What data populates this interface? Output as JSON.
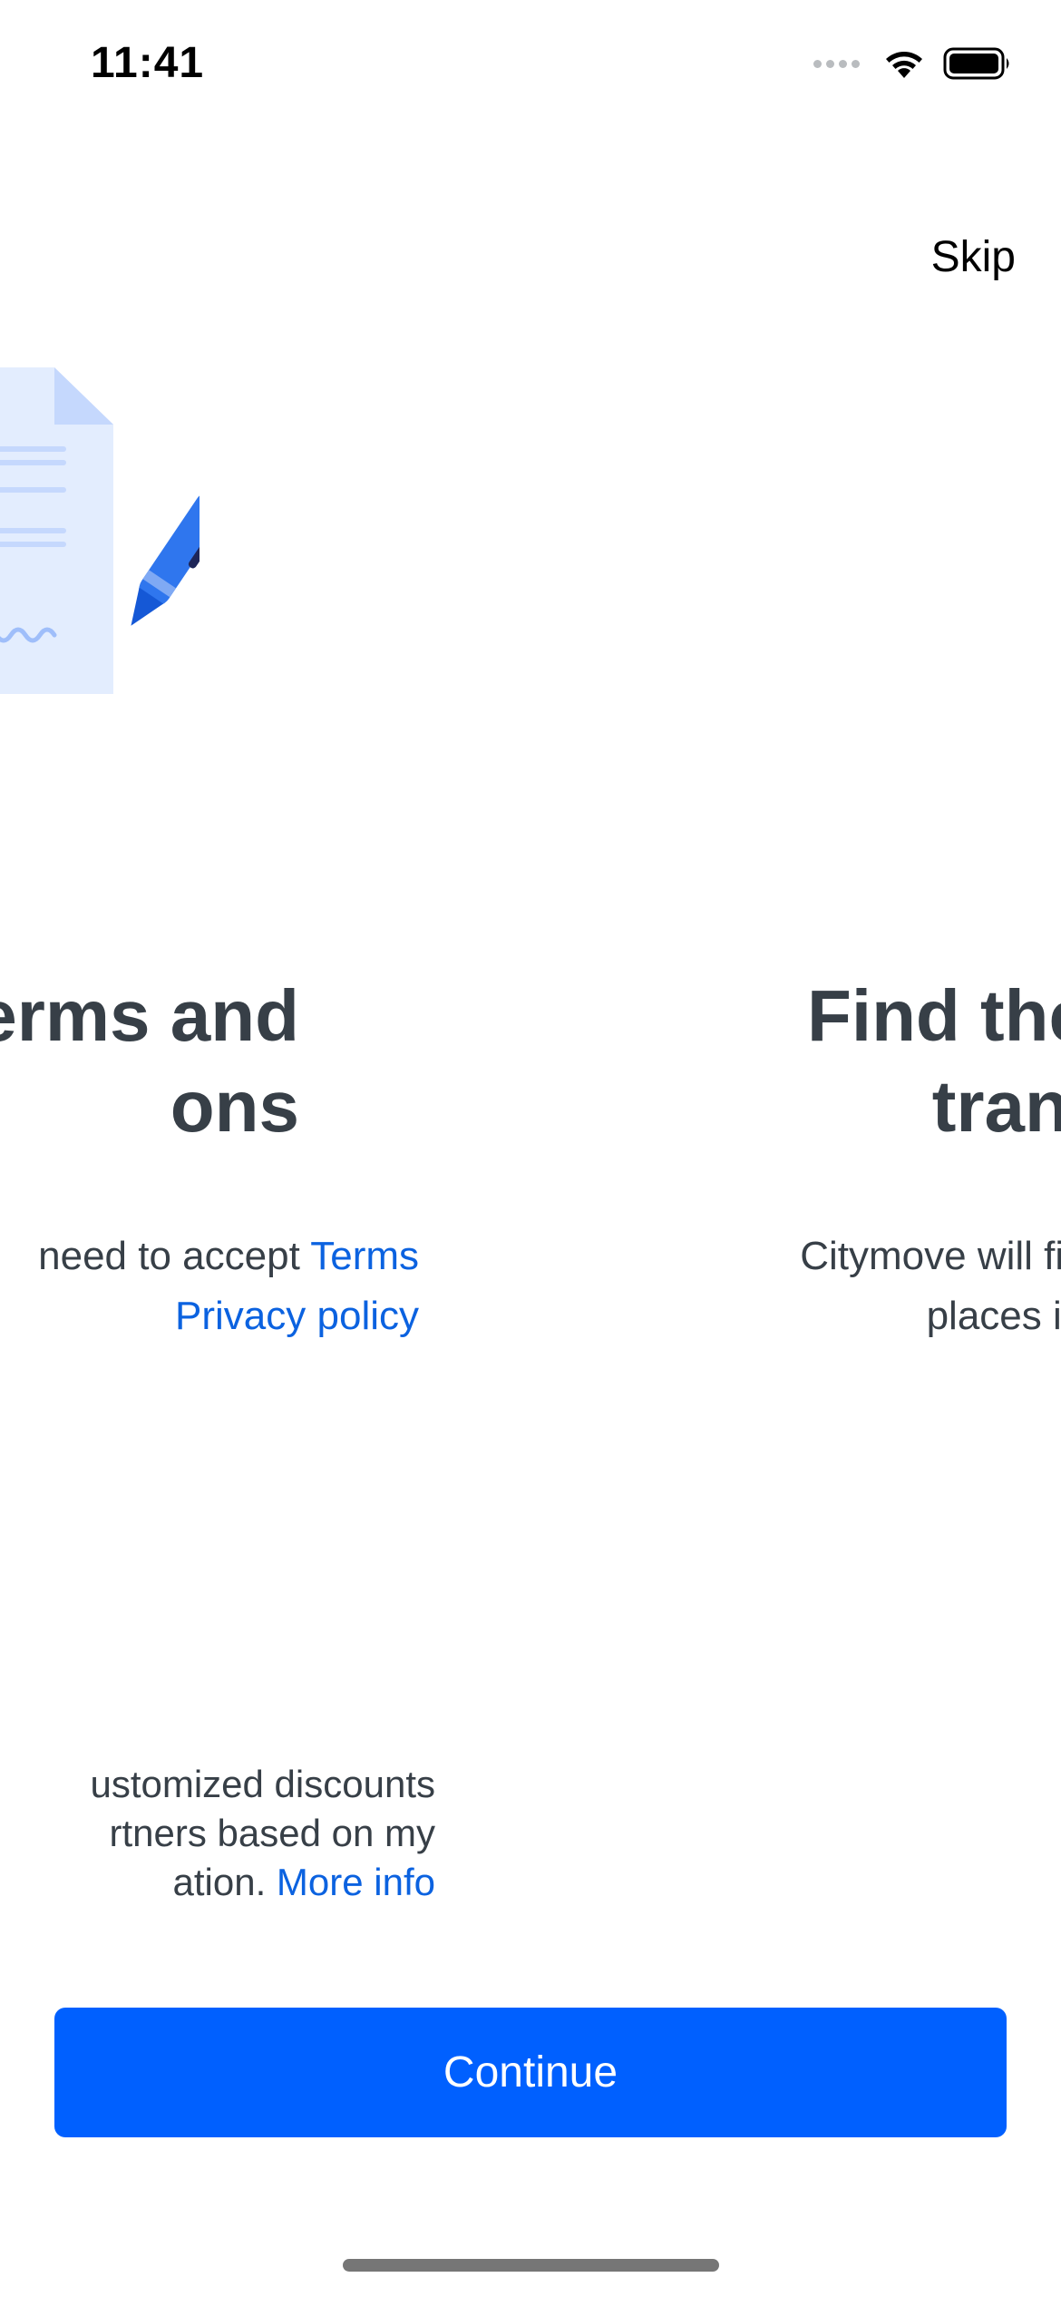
{
  "status_bar": {
    "time": "11:41"
  },
  "header": {
    "skip_label": "Skip"
  },
  "slides": [
    {
      "title_line1": "erms and",
      "title_line2": "ons",
      "desc_line1_text": "need to accept ",
      "desc_line1_link": "Terms",
      "desc_line2_link": "Privacy policy",
      "consent_line1": "ustomized discounts",
      "consent_line2": "rtners based on my",
      "consent_line3_text": "ation. ",
      "consent_line3_link": "More info"
    },
    {
      "title_line1": "Find the faste",
      "title_line2": "transp",
      "desc_line1": "Citymove will find all mobilit",
      "desc_line2": "places in you"
    }
  ],
  "footer": {
    "continue_label": "Continue"
  },
  "colors": {
    "accent": "#0060ff",
    "link": "#0b62e0",
    "text": "#373f47"
  }
}
